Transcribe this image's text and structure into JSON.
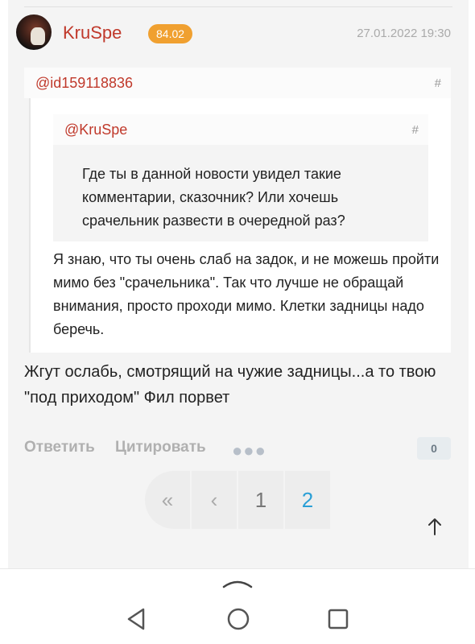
{
  "post": {
    "username": "KruSpe",
    "rating": "84.02",
    "timestamp": "27.01.2022 19:30",
    "quote": {
      "author": "@id159118836",
      "hash": "#",
      "nested_quote": {
        "author": "@KruSpe",
        "hash": "#",
        "text": "Где ты в данной новости увидел такие комментарии, сказочник? Или хочешь срачельник развести в очередной раз?"
      },
      "text": "Я знаю, что ты очень слаб на задок, и не можешь пройти мимо без \"срачельника\". Так что лучше не обращай внимания, просто проходи мимо. Клетки задницы надо беречь."
    },
    "text": "Жгут ослабь, смотрящий на чужие задницы...а то твою \"под приходом\" Фил порвет",
    "actions": {
      "reply": "Ответить",
      "quote": "Цитировать",
      "more": "●●●",
      "likes": "0"
    }
  },
  "pagination": {
    "first": "«",
    "prev": "‹",
    "pages": [
      "1",
      "2"
    ],
    "current": "2"
  },
  "scroll_top_icon": "arrow-up-icon",
  "colors": {
    "username": "#c0392b",
    "rating_badge": "#f0a030",
    "current_page": "#2a9fd6"
  }
}
